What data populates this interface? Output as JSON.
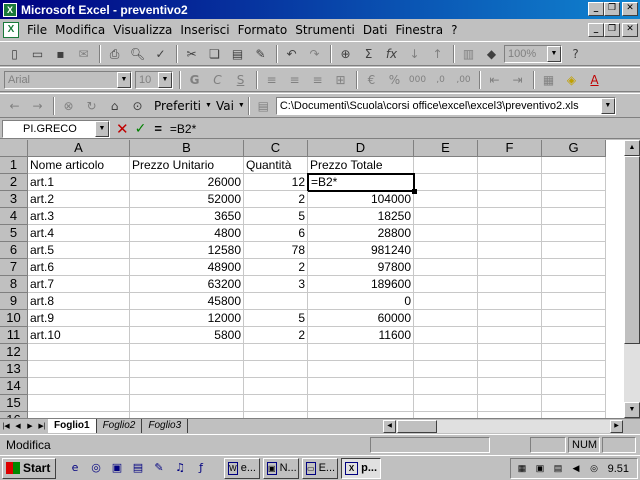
{
  "window": {
    "title": "Microsoft Excel - preventivo2",
    "app_icon": "excel-icon"
  },
  "menu": {
    "items": [
      "File",
      "Modifica",
      "Visualizza",
      "Inserisci",
      "Formato",
      "Strumenti",
      "Dati",
      "Finestra",
      "?"
    ]
  },
  "format_toolbar": {
    "font": "Arial",
    "size": "10",
    "bold": "G",
    "italic": "C",
    "underline": "S"
  },
  "standard_toolbar": {
    "zoom": "100%",
    "sum": "Σ",
    "function": "fx"
  },
  "web_toolbar": {
    "favorites": "Preferiti",
    "go": "Vai",
    "address": "C:\\Documenti\\Scuola\\corsi office\\excel\\excel3\\preventivo2.xls"
  },
  "formula_bar": {
    "name_box": "PI.GRECO",
    "cancel": "✕",
    "confirm": "✓",
    "equals": "=",
    "content": "=B2*"
  },
  "sheet": {
    "columns": [
      "A",
      "B",
      "C",
      "D",
      "E",
      "F",
      "G"
    ],
    "rows": [
      "1",
      "2",
      "3",
      "4",
      "5",
      "6",
      "7",
      "8",
      "9",
      "10",
      "11",
      "12",
      "13",
      "14",
      "15",
      "16"
    ],
    "headers": [
      "Nome articolo",
      "Prezzo Unitario",
      "Quantità",
      "Prezzo Totale"
    ],
    "data": [
      [
        "art.1",
        "26000",
        "12",
        "=B2*"
      ],
      [
        "art.2",
        "52000",
        "2",
        "104000"
      ],
      [
        "art.3",
        "3650",
        "5",
        "18250"
      ],
      [
        "art.4",
        "4800",
        "6",
        "28800"
      ],
      [
        "art.5",
        "12580",
        "78",
        "981240"
      ],
      [
        "art.6",
        "48900",
        "2",
        "97800"
      ],
      [
        "art.7",
        "63200",
        "3",
        "189600"
      ],
      [
        "art.8",
        "45800",
        "",
        "0"
      ],
      [
        "art.9",
        "12000",
        "5",
        "60000"
      ],
      [
        "art.10",
        "5800",
        "2",
        "11600"
      ]
    ],
    "active_cell": "D2"
  },
  "tabs": [
    "Foglio1",
    "Foglio2",
    "Foglio3"
  ],
  "status": {
    "mode": "Modifica",
    "num": "NUM"
  },
  "taskbar": {
    "start": "Start",
    "tasks": [
      "e...",
      "N...",
      "E...",
      "p..."
    ],
    "clock": "9.51"
  }
}
